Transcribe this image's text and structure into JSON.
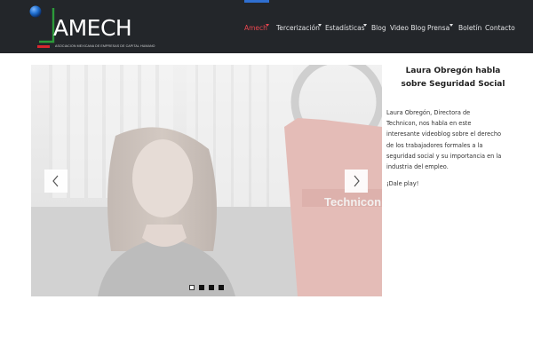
{
  "brand": {
    "name": "AMECH",
    "tagline": "ASOCIACION MEXICANA DE EMPRESAS DE CAPITAL HUMANO",
    "colors": {
      "header_bg": "#23262a",
      "accent_red": "#d9262e",
      "globe_blue": "#1f6fd0",
      "mark_green": "#2c9a3a"
    }
  },
  "nav": {
    "items": [
      {
        "label": "Amech",
        "dropdown": true,
        "active": true
      },
      {
        "label": "Tercerización",
        "dropdown": true,
        "active": false
      },
      {
        "label": "Estadísticas",
        "dropdown": true,
        "active": false
      },
      {
        "label": "Blog",
        "dropdown": false,
        "active": false
      },
      {
        "label": "Video Blog",
        "dropdown": false,
        "active": false
      },
      {
        "label": "Prensa",
        "dropdown": true,
        "active": false
      },
      {
        "label": "Boletín",
        "dropdown": false,
        "active": false
      },
      {
        "label": "Contacto",
        "dropdown": false,
        "active": false
      }
    ]
  },
  "slider": {
    "shirt_text": "Technicon",
    "prev_icon": "chevron-left-icon",
    "next_icon": "chevron-right-icon",
    "slide_count": 4,
    "active_slide": 1
  },
  "article": {
    "title_lines": [
      "Laura Obregón habla",
      "sobre Seguridad Social"
    ],
    "body_lines": [
      "Laura Obregón, Directora de",
      "Technicon, nos habla en este",
      "interesante videoblog sobre el derecho",
      "de los trabajadores formales a la",
      "seguridad social y su importancia en la",
      "industria del empleo."
    ],
    "cta": "¡Dale play!"
  }
}
